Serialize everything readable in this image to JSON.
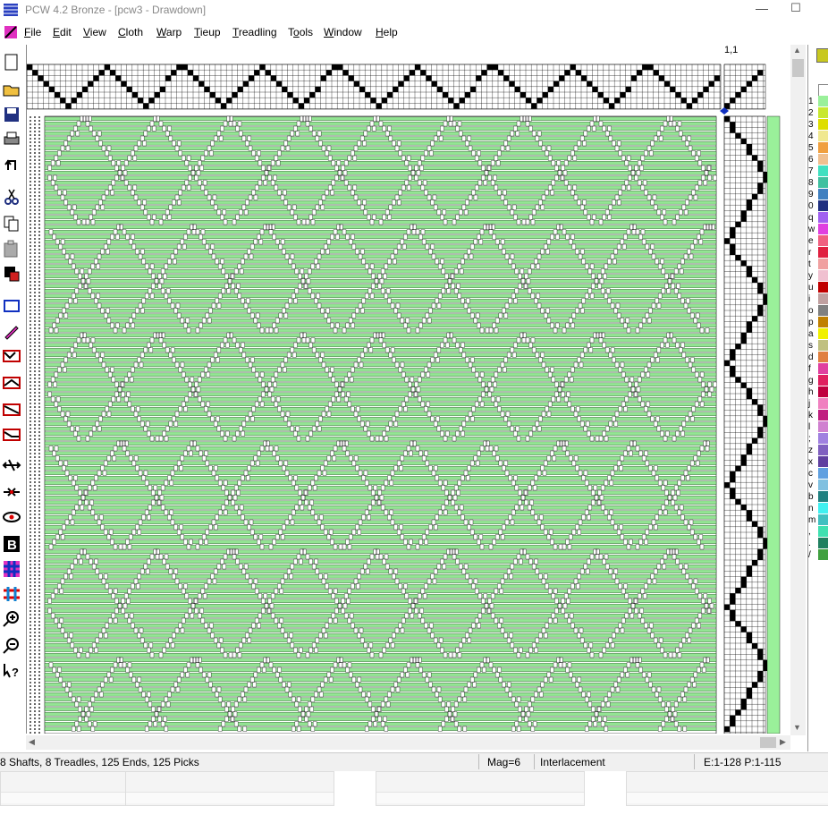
{
  "window": {
    "title": "PCW 4.2 Bronze - [pcw3 - Drawdown]",
    "minimize_glyph": "—",
    "maximize_glyph": "☐"
  },
  "menu": [
    {
      "label": "File",
      "ul": "F"
    },
    {
      "label": "Edit",
      "ul": "E"
    },
    {
      "label": "View",
      "ul": "V"
    },
    {
      "label": "Cloth",
      "ul": "C"
    },
    {
      "label": "Warp",
      "ul": "W"
    },
    {
      "label": "Tieup",
      "ul": "T"
    },
    {
      "label": "Treadling",
      "ul": "T"
    },
    {
      "label": "Tools",
      "ul": "o"
    },
    {
      "label": "Window",
      "ul": "W"
    },
    {
      "label": "Help",
      "ul": "H"
    }
  ],
  "toolbar": [
    {
      "icon": "new-file-icon"
    },
    {
      "icon": "open-folder-icon"
    },
    {
      "icon": "save-icon"
    },
    {
      "icon": "print-icon"
    },
    {
      "icon": "undo-icon"
    },
    {
      "icon": "cut-icon"
    },
    {
      "icon": "copy-icon"
    },
    {
      "icon": "paste-icon"
    },
    {
      "icon": "color-swap-icon"
    },
    {
      "icon": "select-rect-icon"
    },
    {
      "icon": "pencil-icon"
    },
    {
      "icon": "threading-1-icon"
    },
    {
      "icon": "threading-2-icon"
    },
    {
      "icon": "threading-3-icon"
    },
    {
      "icon": "threading-4-icon"
    },
    {
      "icon": "flip-horizontal-icon"
    },
    {
      "icon": "flip-vertical-icon"
    },
    {
      "icon": "eye-icon"
    },
    {
      "icon": "bold-b-icon"
    },
    {
      "icon": "color-grid-icon"
    },
    {
      "icon": "interlace-icon"
    },
    {
      "icon": "zoom-in-icon"
    },
    {
      "icon": "zoom-out-icon"
    },
    {
      "icon": "help-pointer-icon"
    }
  ],
  "corner_label": "1,1",
  "colors": {
    "warp": "#ffffff",
    "weft": "#93e593",
    "edge": "#000000",
    "accent_sash": "#9af09a"
  },
  "palette": [
    {
      "key": "",
      "color": "#ffffff"
    },
    {
      "key": "1",
      "color": "#9af09a"
    },
    {
      "key": "2",
      "color": "#c8e830"
    },
    {
      "key": "3",
      "color": "#dede00"
    },
    {
      "key": "4",
      "color": "#f0e890"
    },
    {
      "key": "5",
      "color": "#f0a040"
    },
    {
      "key": "6",
      "color": "#f0c090"
    },
    {
      "key": "7",
      "color": "#40e0c0"
    },
    {
      "key": "8",
      "color": "#40c0a0"
    },
    {
      "key": "9",
      "color": "#4080c0"
    },
    {
      "key": "0",
      "color": "#203080"
    },
    {
      "key": "q",
      "color": "#a060f0"
    },
    {
      "key": "w",
      "color": "#e040e0"
    },
    {
      "key": "e",
      "color": "#f06080"
    },
    {
      "key": "r",
      "color": "#e02040"
    },
    {
      "key": "t",
      "color": "#f0a0a0"
    },
    {
      "key": "y",
      "color": "#f0c0d0"
    },
    {
      "key": "u",
      "color": "#c00000"
    },
    {
      "key": "i",
      "color": "#c0a0a0"
    },
    {
      "key": "o",
      "color": "#808080"
    },
    {
      "key": "p",
      "color": "#c08000"
    },
    {
      "key": "a",
      "color": "#f0f000"
    },
    {
      "key": "s",
      "color": "#c0c080"
    },
    {
      "key": "d",
      "color": "#e08040"
    },
    {
      "key": "f",
      "color": "#e040a0"
    },
    {
      "key": "g",
      "color": "#e02060"
    },
    {
      "key": "h",
      "color": "#c00040"
    },
    {
      "key": "j",
      "color": "#f080c0"
    },
    {
      "key": "k",
      "color": "#c02080"
    },
    {
      "key": "l",
      "color": "#d080d0"
    },
    {
      "key": ";",
      "color": "#a080e0"
    },
    {
      "key": "z",
      "color": "#8060c0"
    },
    {
      "key": "x",
      "color": "#6040a0"
    },
    {
      "key": "c",
      "color": "#60a0e0"
    },
    {
      "key": "v",
      "color": "#80c0e0"
    },
    {
      "key": "b",
      "color": "#208080"
    },
    {
      "key": "n",
      "color": "#40f0f0"
    },
    {
      "key": "m",
      "color": "#40c0c0"
    },
    {
      "key": ",",
      "color": "#40e0b0"
    },
    {
      "key": ".",
      "color": "#208060"
    },
    {
      "key": "/",
      "color": "#40a040"
    }
  ],
  "status": {
    "summary": "8 Shafts, 8 Treadles, 125 Ends, 125 Picks",
    "mag": "Mag=6",
    "mode": "Interlacement",
    "range": "E:1-128  P:1-115"
  },
  "scroll": {
    "up": "▲",
    "down": "▼",
    "left": "◀",
    "right": "▶"
  }
}
